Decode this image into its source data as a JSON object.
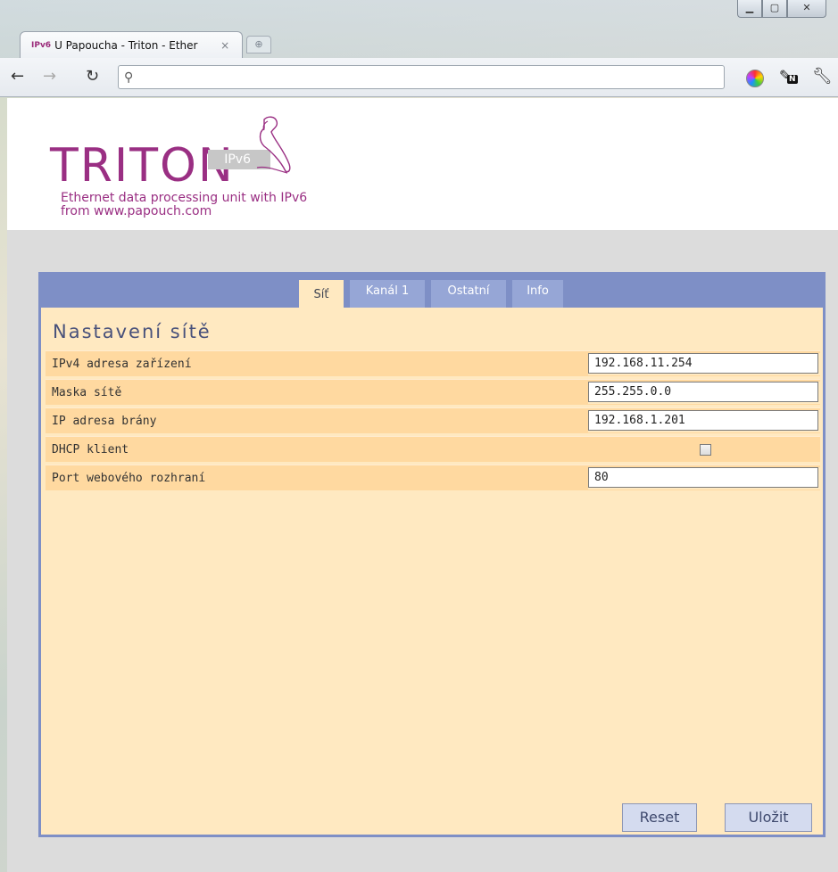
{
  "browser": {
    "tab_favicon": "IPv6",
    "tab_title": "U Papoucha - Triton - Ether",
    "tab_close": "×",
    "new_tab": "⊕",
    "address_value": "",
    "address_placeholder": "",
    "ext_badge": "N",
    "window_controls": {
      "minimize": "▁",
      "maximize": "▢",
      "close": "✕"
    }
  },
  "header": {
    "logo_word": "TRITON",
    "logo_badge": "IPv6",
    "tagline_line1": "Ethernet data processing unit with IPv6",
    "tagline_line2": "from www.papouch.com"
  },
  "tabs": [
    {
      "label": "Síť",
      "active": true
    },
    {
      "label": "Kanál 1",
      "active": false
    },
    {
      "label": "Ostatní",
      "active": false
    },
    {
      "label": "Info",
      "active": false
    }
  ],
  "section": {
    "title": "Nastavení sítě"
  },
  "fields": {
    "ipv4": {
      "label": "IPv4 adresa zařízení",
      "value": "192.168.11.254"
    },
    "mask": {
      "label": "Maska sítě",
      "value": "255.255.0.0"
    },
    "gateway": {
      "label": "IP adresa brány",
      "value": "192.168.1.201"
    },
    "dhcp": {
      "label": "DHCP klient",
      "checked": false
    },
    "port": {
      "label": "Port webového rozhraní",
      "value": "80"
    }
  },
  "buttons": {
    "reset": "Reset",
    "save": "Uložit"
  },
  "colors": {
    "brand": "#9a2f83",
    "panel_border": "#7e8fc6",
    "panel_bg": "#ffe9c1",
    "row_bg": "#ffd9a0",
    "title_color": "#48517b"
  }
}
